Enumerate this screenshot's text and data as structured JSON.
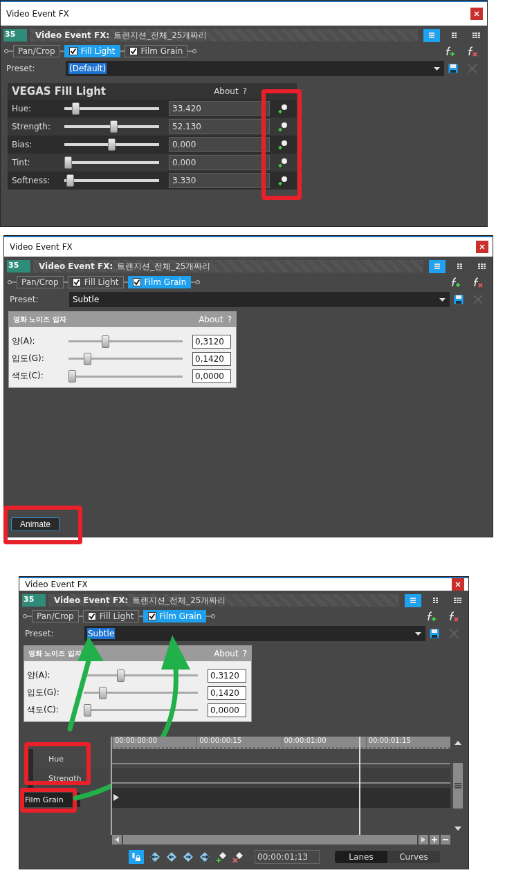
{
  "windows": [
    {
      "title": "Video Event FX",
      "thumb_text": "35",
      "header_label": "Video Event FX:",
      "event_name": "트랜지션_전체_25개짜리",
      "view_modes": [
        {
          "selected": true
        },
        {
          "selected": false
        },
        {
          "selected": false
        }
      ],
      "chain": [
        {
          "kind": "plain",
          "label": "Pan/Crop",
          "selected": false
        },
        {
          "kind": "checkbox",
          "label": "Fill Light",
          "checked": true,
          "selected": true
        },
        {
          "kind": "checkbox",
          "label": "Film Grain",
          "checked": true,
          "selected": false
        }
      ],
      "preset": {
        "label": "Preset:",
        "value": "(Default)",
        "highlighted": true
      },
      "plugin": {
        "kind": "dark",
        "title": "VEGAS Fill Light",
        "about": "About",
        "help": "?",
        "keyframes_marked": true,
        "rows": [
          {
            "label": "Hue:",
            "level": 0.09,
            "value": "33.420"
          },
          {
            "label": "Strength:",
            "level": 0.52,
            "value": "52.130"
          },
          {
            "label": "Bias:",
            "level": 0.5,
            "value": "0.000"
          },
          {
            "label": "Tint:",
            "level": 0,
            "value": "0.000"
          },
          {
            "label": "Softness:",
            "level": 0.02,
            "value": "3.330"
          }
        ]
      }
    },
    {
      "title": "Video Event FX",
      "thumb_text": "35",
      "header_label": "Video Event FX:",
      "event_name": "트랜지션_전체_25개짜리",
      "view_modes": [
        {
          "selected": true
        },
        {
          "selected": false
        },
        {
          "selected": false
        }
      ],
      "chain": [
        {
          "kind": "plain",
          "label": "Pan/Crop",
          "selected": false
        },
        {
          "kind": "checkbox",
          "label": "Fill Light",
          "checked": true,
          "selected": false
        },
        {
          "kind": "checkbox",
          "label": "Film Grain",
          "checked": true,
          "selected": true
        }
      ],
      "preset": {
        "label": "Preset:",
        "value": "Subtle",
        "highlighted": false
      },
      "plugin": {
        "kind": "light",
        "title": "영화 노이즈 입자",
        "about": "About",
        "help": "?",
        "rows": [
          {
            "label": "양(A):",
            "level": 0.31,
            "value": "0,3120"
          },
          {
            "label": "입도(G):",
            "level": 0.14,
            "value": "0,1420"
          },
          {
            "label": "색도(C):",
            "level": 0,
            "value": "0,0000"
          }
        ]
      },
      "animate_button": {
        "label": "Animate",
        "marked": true
      }
    },
    {
      "title": "Video Event FX",
      "thumb_text": "35",
      "header_label": "Video Event FX:",
      "event_name": "트랜지션_전체_25개짜리",
      "view_modes": [
        {
          "selected": true
        },
        {
          "selected": false
        },
        {
          "selected": false
        }
      ],
      "chain": [
        {
          "kind": "plain",
          "label": "Pan/Crop",
          "selected": false
        },
        {
          "kind": "checkbox",
          "label": "Fill Light",
          "checked": true,
          "selected": false
        },
        {
          "kind": "checkbox",
          "label": "Film Grain",
          "checked": true,
          "selected": true
        }
      ],
      "preset": {
        "label": "Preset:",
        "value": "Subtle",
        "highlighted": true
      },
      "plugin": {
        "kind": "light",
        "title": "영화 노이즈 입자",
        "about": "About",
        "help": "?",
        "rows": [
          {
            "label": "양(A):",
            "level": 0.31,
            "value": "0,3120"
          },
          {
            "label": "입도(G):",
            "level": 0.14,
            "value": "0,1420"
          },
          {
            "label": "색도(C):",
            "level": 0,
            "value": "0,0000"
          }
        ]
      },
      "timeline": {
        "ruler": [
          "00:00:00:00",
          "00:00:00:15",
          "00:00:01:00",
          "00:00:01:15"
        ],
        "playhead": {
          "level": 0.73
        },
        "tracks": [
          {
            "kind": "param",
            "label": "Hue"
          },
          {
            "kind": "param",
            "label": "Strength"
          },
          {
            "kind": "effect",
            "label": "Film Grain"
          }
        ],
        "params_marked": true,
        "effect_marked": true,
        "arrows": true,
        "sync_locked": true,
        "time": "00:00:01;13",
        "modes": [
          {
            "label": "Lanes",
            "selected": true
          },
          {
            "label": "Curves",
            "selected": false
          }
        ]
      }
    }
  ]
}
